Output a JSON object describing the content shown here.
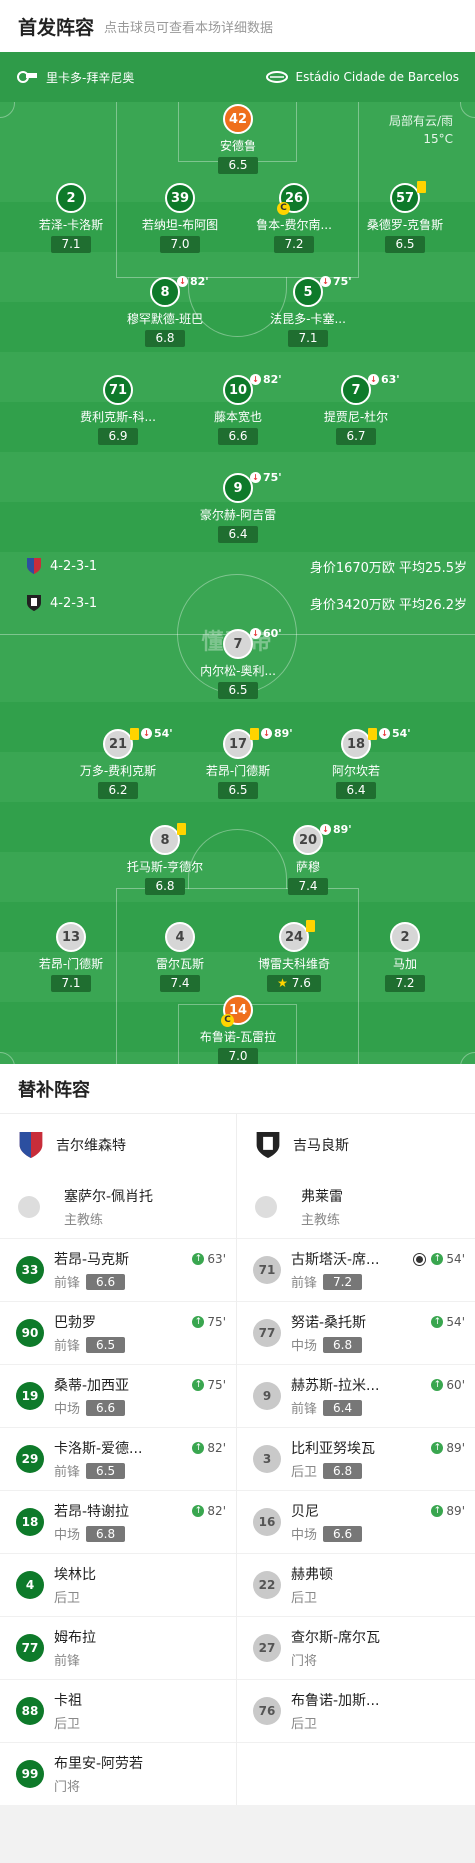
{
  "header": {
    "title": "首发阵容",
    "subtitle": "点击球员可查看本场详细数据"
  },
  "venue": {
    "referee": "里卡多-拜辛尼奥",
    "stadium": "Estádio Cidade de Barcelos"
  },
  "weather": {
    "desc": "局部有云/雨",
    "temp": "15°C"
  },
  "watermark": "懂球帝",
  "home": {
    "formation": "4-2-3-1",
    "value": "身价1670万欧  平均25.5岁",
    "players": [
      {
        "no": "42",
        "name": "安德鲁",
        "rating": "6.5",
        "gk": true
      },
      {
        "no": "2",
        "name": "若泽-卡洛斯",
        "rating": "7.1"
      },
      {
        "no": "39",
        "name": "若纳坦-布阿图",
        "rating": "7.0"
      },
      {
        "no": "26",
        "name": "鲁本-费尔南...",
        "rating": "7.2",
        "cap": "C"
      },
      {
        "no": "57",
        "name": "桑德罗-克鲁斯",
        "rating": "6.5"
      },
      {
        "no": "8",
        "name": "穆罕默德-班巴",
        "rating": "6.8",
        "sub": "82'"
      },
      {
        "no": "5",
        "name": "法昆多-卡塞...",
        "rating": "7.1",
        "sub": "75'"
      },
      {
        "no": "71",
        "name": "费利克斯-科...",
        "rating": "6.9"
      },
      {
        "no": "10",
        "name": "藤本宽也",
        "rating": "6.6",
        "sub": "82'"
      },
      {
        "no": "7",
        "name": "提贾尼-杜尔",
        "rating": "6.7",
        "sub": "63'"
      },
      {
        "no": "9",
        "name": "豪尔赫-阿吉雷",
        "rating": "6.4",
        "sub": "75'"
      }
    ]
  },
  "away": {
    "formation": "4-2-3-1",
    "value": "身价3420万欧  平均26.2岁",
    "players": [
      {
        "no": "7",
        "name": "内尔松-奥利...",
        "rating": "6.5",
        "sub": "60'"
      },
      {
        "no": "21",
        "name": "万多-费利克斯",
        "rating": "6.2",
        "sub": "54'"
      },
      {
        "no": "17",
        "name": "若昂-门德斯",
        "rating": "6.5",
        "sub": "89'"
      },
      {
        "no": "18",
        "name": "阿尔坎若",
        "rating": "6.4",
        "sub": "54'"
      },
      {
        "no": "8",
        "name": "托马斯-亨德尔",
        "rating": "6.8"
      },
      {
        "no": "20",
        "name": "萨穆",
        "rating": "7.4",
        "sub": "89'"
      },
      {
        "no": "13",
        "name": "若昂-门德斯",
        "rating": "7.1"
      },
      {
        "no": "4",
        "name": "雷尔瓦斯",
        "rating": "7.4"
      },
      {
        "no": "24",
        "name": "博雷夫科维奇",
        "rating": "7.6",
        "star": "★"
      },
      {
        "no": "2",
        "name": "马加",
        "rating": "7.2"
      },
      {
        "no": "14",
        "name": "布鲁诺-瓦雷拉",
        "rating": "7.0",
        "gk": true,
        "cap": "C"
      }
    ]
  },
  "subs": {
    "title": "替补阵容",
    "home": {
      "team": "吉尔维森特",
      "coach": {
        "name": "塞萨尔-佩肖托",
        "role": "主教练"
      },
      "list": [
        {
          "no": "33",
          "name": "若昂-马克斯",
          "pos": "前锋",
          "rating": "6.6",
          "in": "63'"
        },
        {
          "no": "90",
          "name": "巴勃罗",
          "pos": "前锋",
          "rating": "6.5",
          "in": "75'"
        },
        {
          "no": "19",
          "name": "桑蒂-加西亚",
          "pos": "中场",
          "rating": "6.6",
          "in": "75'"
        },
        {
          "no": "29",
          "name": "卡洛斯-爱德...",
          "pos": "前锋",
          "rating": "6.5",
          "in": "82'"
        },
        {
          "no": "18",
          "name": "若昂-特谢拉",
          "pos": "中场",
          "rating": "6.8",
          "in": "82'"
        },
        {
          "no": "4",
          "name": "埃林比",
          "pos": "后卫"
        },
        {
          "no": "77",
          "name": "姆布拉",
          "pos": "前锋"
        },
        {
          "no": "88",
          "name": "卡祖",
          "pos": "后卫"
        },
        {
          "no": "99",
          "name": "布里安-阿劳若",
          "pos": "门将"
        }
      ]
    },
    "away": {
      "team": "吉马良斯",
      "coach": {
        "name": "弗莱雷",
        "role": "主教练"
      },
      "list": [
        {
          "no": "71",
          "name": "古斯塔沃-席...",
          "pos": "前锋",
          "rating": "7.2",
          "in": "54'",
          "goal": true
        },
        {
          "no": "77",
          "name": "努诺-桑托斯",
          "pos": "中场",
          "rating": "6.8",
          "in": "54'"
        },
        {
          "no": "9",
          "name": "赫苏斯-拉米...",
          "pos": "前锋",
          "rating": "6.4",
          "in": "60'"
        },
        {
          "no": "3",
          "name": "比利亚努埃瓦",
          "pos": "后卫",
          "rating": "6.8",
          "in": "89'"
        },
        {
          "no": "16",
          "name": "贝尼",
          "pos": "中场",
          "rating": "6.6",
          "in": "89'"
        },
        {
          "no": "22",
          "name": "赫弗顿",
          "pos": "后卫"
        },
        {
          "no": "27",
          "name": "查尔斯-席尔瓦",
          "pos": "门将"
        },
        {
          "no": "76",
          "name": "布鲁诺-加斯...",
          "pos": "后卫"
        }
      ]
    }
  }
}
